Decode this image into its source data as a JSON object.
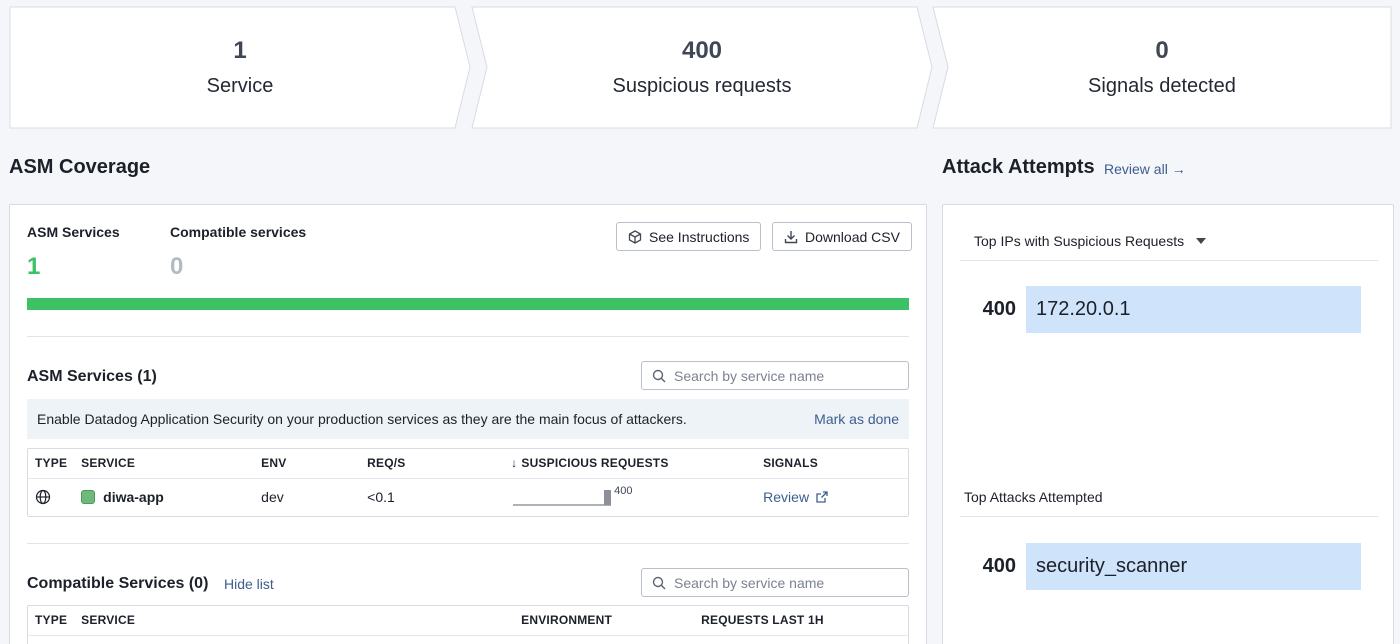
{
  "stats": [
    {
      "value": "1",
      "label": "Service"
    },
    {
      "value": "400",
      "label": "Suspicious requests"
    },
    {
      "value": "0",
      "label": "Signals detected"
    }
  ],
  "coverage": {
    "title": "ASM Coverage",
    "asm_services_label": "ASM Services",
    "asm_services_count": "1",
    "compatible_label": "Compatible services",
    "compatible_count": "0",
    "see_instructions": "See Instructions",
    "download_csv": "Download CSV",
    "coverage_fraction": 1.0,
    "accent": "#3dc167"
  },
  "asm_services": {
    "title": "ASM Services (1)",
    "search_placeholder": "Search by service name",
    "banner_text": "Enable Datadog Application Security on your production services as they are the main focus of attackers.",
    "mark_done": "Mark as done",
    "columns": [
      "TYPE",
      "SERVICE",
      "ENV",
      "REQ/S",
      "SUSPICIOUS REQUESTS",
      "SIGNALS"
    ],
    "sort_arrow": "↓",
    "rows": [
      {
        "service": "diwa-app",
        "env": "dev",
        "req_s": "<0.1",
        "suspicious": "400",
        "signals": "Review"
      }
    ]
  },
  "compatible_services": {
    "title": "Compatible Services (0)",
    "hide_list": "Hide list",
    "search_placeholder": "Search by service name",
    "columns": [
      "TYPE",
      "SERVICE",
      "ENVIRONMENT",
      "REQUESTS LAST 1H"
    ]
  },
  "attacks": {
    "title": "Attack Attempts",
    "review_all": "Review all →",
    "dropdown_label": "Top IPs with Suspicious Requests",
    "ips": [
      {
        "count": "400",
        "value": "172.20.0.1"
      }
    ],
    "top_attacks_label": "Top Attacks Attempted",
    "top_attacks": [
      {
        "count": "400",
        "value": "security_scanner"
      }
    ]
  }
}
